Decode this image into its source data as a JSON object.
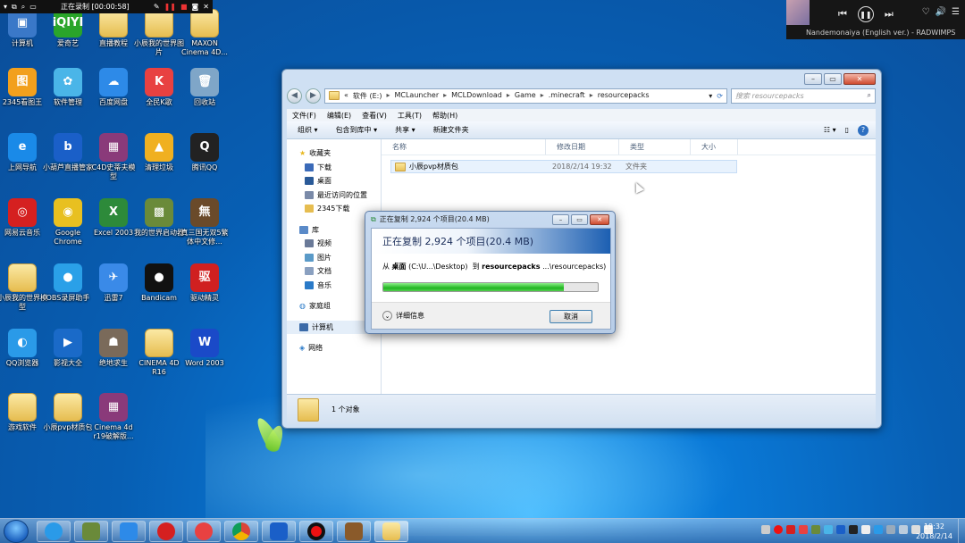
{
  "recorder": {
    "title": "正在录制 [00:00:58]"
  },
  "music": {
    "song": "Nandemonaiya (English ver.) - RADWIMPS"
  },
  "desktop_icons": [
    {
      "label": "计算机",
      "color": "#3a78c8",
      "glyph": "▣"
    },
    {
      "label": "爱奇艺",
      "color": "#2aa52a",
      "glyph": "iQIYI"
    },
    {
      "label": "直播教程",
      "color": "#e9c25a",
      "glyph": ""
    },
    {
      "label": "小辰我的世界图片",
      "color": "#d9b869",
      "glyph": ""
    },
    {
      "label": "MAXON Cinema 4D...",
      "color": "#e9c25a",
      "glyph": ""
    },
    {
      "label": "2345看图王",
      "color": "#f2a01d",
      "glyph": "图"
    },
    {
      "label": "软件管理",
      "color": "#4ab5e8",
      "glyph": "✿"
    },
    {
      "label": "百度网盘",
      "color": "#2d8ae8",
      "glyph": "☁"
    },
    {
      "label": "全民K歌",
      "color": "#e84141",
      "glyph": "K"
    },
    {
      "label": "回收站",
      "color": "#7fa6c8",
      "glyph": "🗑"
    },
    {
      "label": "上网导航",
      "color": "#1a8ae8",
      "glyph": "e"
    },
    {
      "label": "小葫芦直播管家",
      "color": "#1a5fc8",
      "glyph": "b"
    },
    {
      "label": "C4D史蒂夫模型",
      "color": "#8a3a7a",
      "glyph": "▦"
    },
    {
      "label": "清理垃圾",
      "color": "#f0b020",
      "glyph": "▲"
    },
    {
      "label": "腾讯QQ",
      "color": "#222222",
      "glyph": "Q"
    },
    {
      "label": "网易云音乐",
      "color": "#d52020",
      "glyph": "◎"
    },
    {
      "label": "Google Chrome",
      "color": "#e8c020",
      "glyph": "◉"
    },
    {
      "label": "Excel 2003",
      "color": "#2d8a3a",
      "glyph": "X"
    },
    {
      "label": "我的世界启动器",
      "color": "#6a8a3a",
      "glyph": "▩"
    },
    {
      "label": "真三国无双5繁体中文修...",
      "color": "#6a4a2a",
      "glyph": "無"
    },
    {
      "label": "小辰我的世界模型",
      "color": "#e9c25a",
      "glyph": ""
    },
    {
      "label": "OBS录屏助手",
      "color": "#2aa0e8",
      "glyph": "●"
    },
    {
      "label": "迅雷7",
      "color": "#3a8ae8",
      "glyph": "✈"
    },
    {
      "label": "Bandicam",
      "color": "#111111",
      "glyph": "●"
    },
    {
      "label": "驱动精灵",
      "color": "#d02020",
      "glyph": "驱"
    },
    {
      "label": "QQ浏览器",
      "color": "#2a9ae8",
      "glyph": "◐"
    },
    {
      "label": "影视大全",
      "color": "#1a6ac8",
      "glyph": "▶"
    },
    {
      "label": "绝地求生",
      "color": "#7a6a5a",
      "glyph": "☗"
    },
    {
      "label": "CINEMA 4D R16",
      "color": "#e9c25a",
      "glyph": ""
    },
    {
      "label": "Word 2003",
      "color": "#1a4ac8",
      "glyph": "W"
    },
    {
      "label": "游戏软件",
      "color": "#e9c25a",
      "glyph": ""
    },
    {
      "label": "小辰pvp材质包",
      "color": "#d9b869",
      "glyph": ""
    },
    {
      "label": "Cinema 4d r19破解版...",
      "color": "#8a3a7a",
      "glyph": "▦"
    }
  ],
  "explorer": {
    "address": [
      "«",
      "软件 (E:)",
      "MCLauncher",
      "MCLDownload",
      "Game",
      ".minecraft",
      "resourcepacks"
    ],
    "search_placeholder": "搜索 resourcepacks",
    "menu": [
      "文件(F)",
      "编辑(E)",
      "查看(V)",
      "工具(T)",
      "帮助(H)"
    ],
    "toolbar": [
      "组织 ▾",
      "包含到库中 ▾",
      "共享 ▾",
      "新建文件夹"
    ],
    "favorites_label": "收藏夹",
    "favorites": [
      "下载",
      "桌面",
      "最近访问的位置",
      "2345下载"
    ],
    "library_label": "库",
    "libraries": [
      "视频",
      "图片",
      "文档",
      "音乐"
    ],
    "homegroup": "家庭组",
    "computer": "计算机",
    "network": "网络",
    "columns": [
      "名称",
      "修改日期",
      "类型",
      "大小"
    ],
    "file": {
      "name": "小辰pvp材质包",
      "date": "2018/2/14 19:32",
      "type": "文件夹",
      "size": ""
    },
    "status": "1 个对象"
  },
  "dialog": {
    "window_title": "正在复制 2,924 个项目(20.4 MB)",
    "heading": "正在复制 2,924 个项目(20.4 MB)",
    "from_prefix": "从",
    "from_name": "桌面",
    "from_path": "(C:\\U...\\Desktop)",
    "to_prefix": "到",
    "to_name": "resourcepacks",
    "to_path": "...\\resourcepacks)",
    "progress": 0.84,
    "details": "详细信息",
    "cancel": "取消"
  },
  "clock": {
    "time": "19:32",
    "date": "2018/2/14"
  }
}
